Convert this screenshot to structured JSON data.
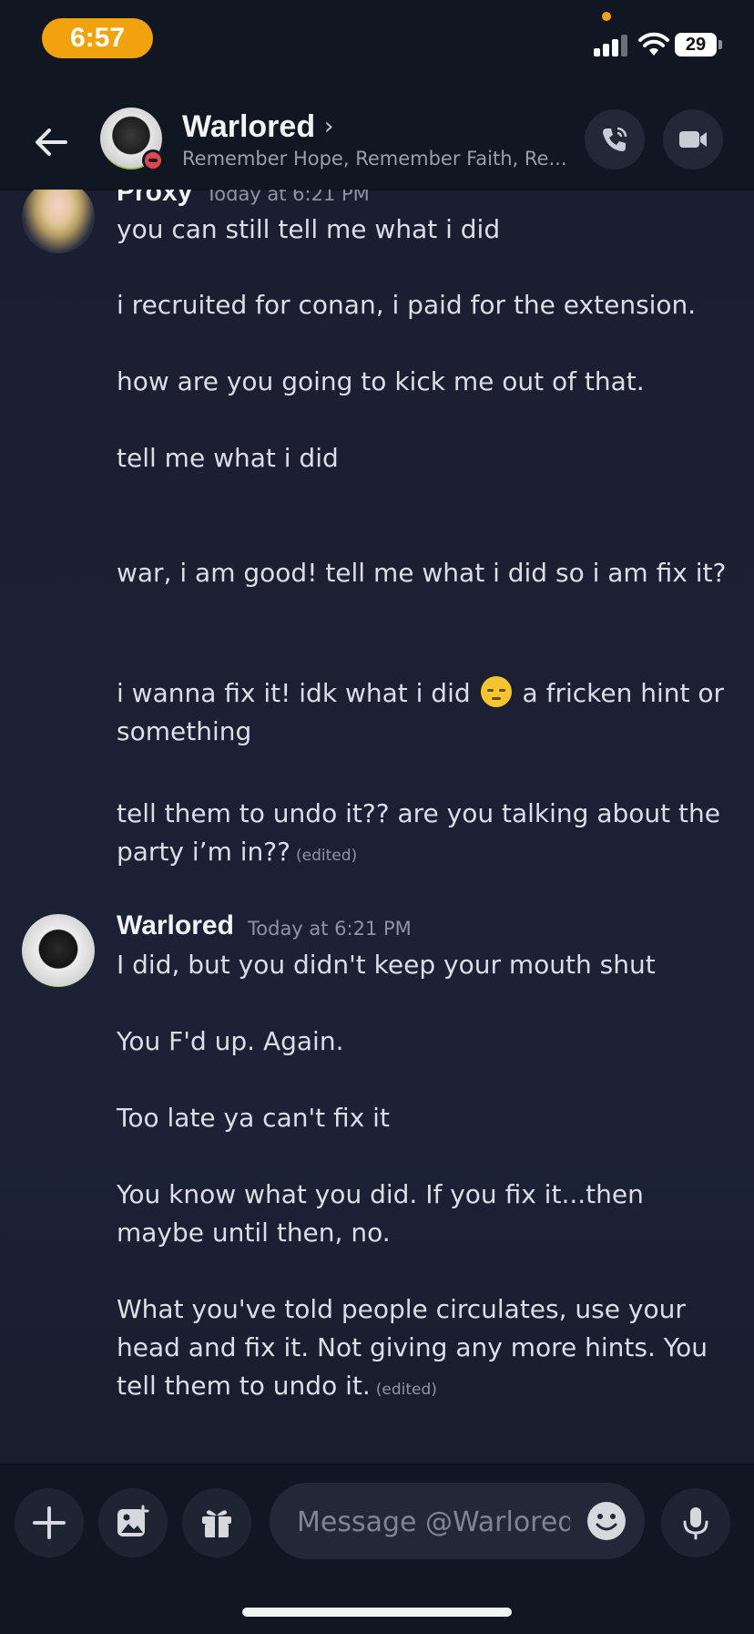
{
  "status_bar": {
    "time": "6:57",
    "battery": "29"
  },
  "header": {
    "name": "Warlored",
    "chevron": "›",
    "status": "Remember Hope, Remember Faith, Re..."
  },
  "messages": [
    {
      "author": "Proxy",
      "timestamp": "Today at 6:21 PM",
      "lines": [
        "you can still tell me what i did",
        "i recruited for conan, i paid for the extension.",
        "how are you going to kick me out of that.",
        "tell me what i did",
        "war, i am good! tell me what i did so i am fix it?",
        "i wanna fix it! idk what i did",
        "a fricken hint or something",
        "tell them to undo it?? are you talking about the party i’m in??"
      ],
      "edited": "(edited)"
    },
    {
      "author": "Warlored",
      "timestamp": "Today at 6:21 PM",
      "lines": [
        "I did, but you didn't keep your mouth shut",
        "You F'd up. Again.",
        "Too late ya can't fix it",
        "You know what you did. If you fix it...then maybe until then, no.",
        "What you've told people circulates, use your head and fix it. Not giving any more hints. You tell them to undo it."
      ],
      "edited": "(edited)"
    }
  ],
  "composer": {
    "placeholder": "Message @Warlored"
  },
  "icons": [
    "back-arrow-icon",
    "call-icon",
    "video-icon",
    "plus-icon",
    "image-icon",
    "gift-icon",
    "emoji-icon",
    "microphone-icon"
  ],
  "colors": {
    "accent_orange": "#f2a20c",
    "dnd_red": "#e0484f",
    "background": "#1d1f33"
  }
}
